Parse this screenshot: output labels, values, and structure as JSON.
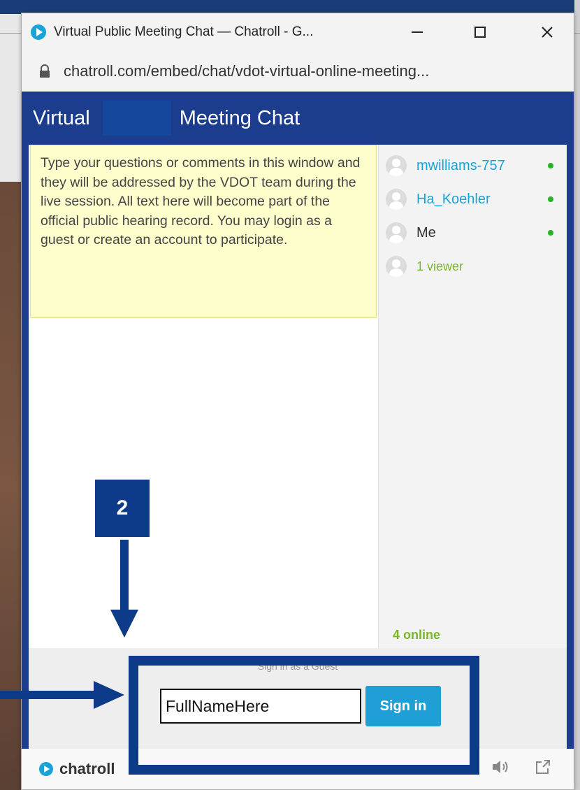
{
  "window": {
    "title": "Virtual Public Meeting Chat — Chatroll - G...",
    "url": "chatroll.com/embed/chat/vdot-virtual-online-meeting..."
  },
  "chat": {
    "title_part1": "Virtual",
    "title_part2": "Meeting Chat",
    "notice": "Type your questions or comments in this window and they will be addressed by the VDOT team during the live session. All text here will become part of the official public hearing record. You may login as a guest or create an account to participate.",
    "users": [
      {
        "name": "mwilliams-757",
        "online": true
      },
      {
        "name": "Ha_Koehler",
        "online": true
      },
      {
        "name": "Me",
        "online": true
      }
    ],
    "viewers": "1 viewer",
    "online_count": "4 online",
    "signin_label": "Sign in as a Guest",
    "name_input_value": "FullNameHere",
    "signin_button": "Sign in",
    "brand": "chatroll"
  },
  "annotation": {
    "step_number": "2"
  },
  "colors": {
    "header_blue": "#1c3d8e",
    "annotation_blue": "#0d3b8a",
    "link_blue": "#1aa3d8",
    "online_green": "#23b523"
  }
}
